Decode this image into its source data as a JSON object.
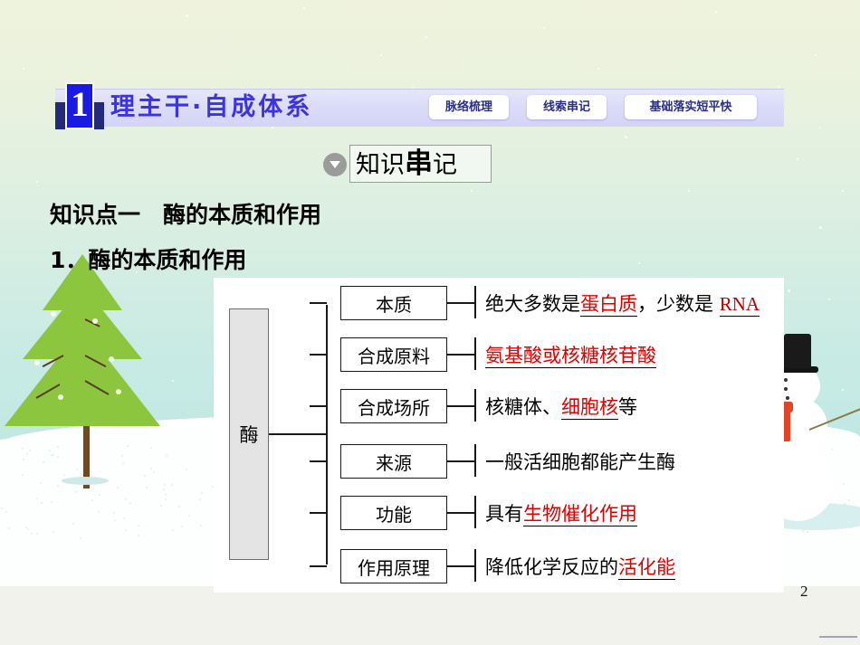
{
  "slide": {
    "page_number": "2"
  },
  "banner": {
    "badge_number": "1",
    "title": "理主干·自成体系",
    "pills": [
      {
        "label": "脉络梳理"
      },
      {
        "label": "线索串记"
      },
      {
        "label": "基础落实短平快"
      }
    ]
  },
  "section_tag": {
    "icon": "circle-down-triangle-icon",
    "text_normal_1": "知识",
    "text_bold": "串",
    "text_normal_2": "记"
  },
  "headings": {
    "knowledge_point": "知识点一　酶的本质和作用",
    "sub_heading": "1．酶的本质和作用"
  },
  "diagram": {
    "root_label": "酶",
    "rows": [
      {
        "node": "本质",
        "text_parts": [
          {
            "text": "绝大多数是",
            "style": "black"
          },
          {
            "text": "蛋白质",
            "style": "red-underline"
          },
          {
            "text": "，少数是 ",
            "style": "black"
          },
          {
            "text": "RNA",
            "style": "red-underline-serif"
          }
        ]
      },
      {
        "node": "合成原料",
        "text_parts": [
          {
            "text": "氨基酸或核糖核苷酸",
            "style": "red-underline"
          }
        ]
      },
      {
        "node": "合成场所",
        "text_parts": [
          {
            "text": "核糖体、",
            "style": "black"
          },
          {
            "text": "细胞核",
            "style": "red-underline"
          },
          {
            "text": "等",
            "style": "black"
          }
        ]
      },
      {
        "node": "来源",
        "text_parts": [
          {
            "text": "一般活细胞都能产生酶",
            "style": "black"
          }
        ]
      },
      {
        "node": "功能",
        "text_parts": [
          {
            "text": "具有",
            "style": "black"
          },
          {
            "text": "生物催化作用",
            "style": "red-underline"
          }
        ]
      },
      {
        "node": "作用原理",
        "text_parts": [
          {
            "text": "降低化学反应的",
            "style": "black"
          },
          {
            "text": "活化能",
            "style": "red-underline"
          }
        ]
      }
    ]
  },
  "decorations": {
    "tree": "christmas-tree",
    "snowman": "snowman",
    "colors": {
      "banner_bg": "#dcdcf9",
      "banner_text": "#3b34e0",
      "badge_blue": "#1a1ae0",
      "badge_navy": "#232a7a",
      "accent_red": "#e00000",
      "sky_top": "#eff3dd",
      "sky_bottom": "#c2e8e3",
      "snow": "#ffffff",
      "tree_green": "#7fc242",
      "tree_trunk": "#6c4a24",
      "scarf_red": "#e0452a"
    }
  }
}
